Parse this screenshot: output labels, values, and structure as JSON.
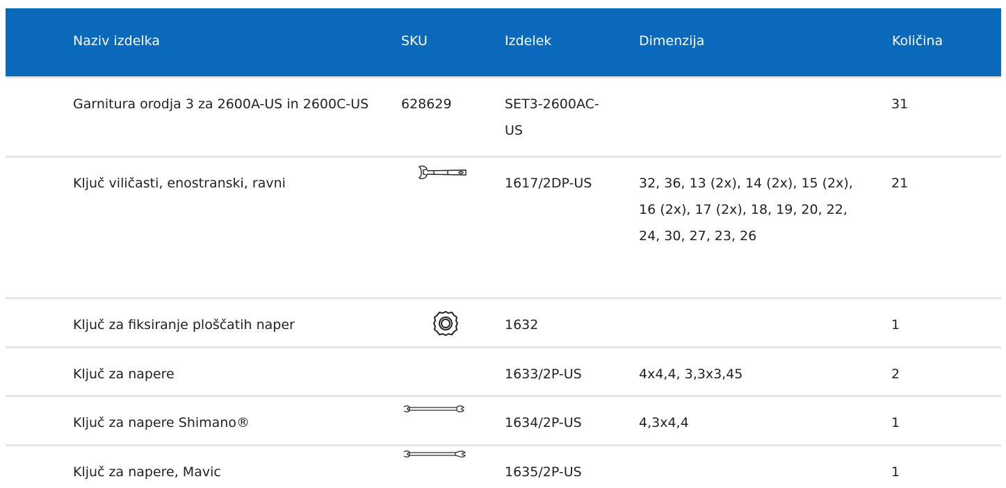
{
  "header": {
    "name": "Naziv izdelka",
    "sku": "SKU",
    "item": "Izdelek",
    "dimension": "Dimenzija",
    "quantity": "Količina"
  },
  "colors": {
    "header_bg": "#0a69bb",
    "header_text": "#ffffff",
    "row_divider": "#e6e6e6"
  },
  "rows": [
    {
      "name": "Garnitura orodja 3 za 2600A-US in 2600C-US",
      "sku": "628629",
      "icon": "",
      "item": "SET3-2600AC-US",
      "dimension": "",
      "quantity": "31"
    },
    {
      "name": "Ključ viličasti, enostranski, ravni",
      "sku": "",
      "icon": "open-end-wrench-icon",
      "item": "1617/2DP-US",
      "dimension": "32, 36, 13 (2x), 14 (2x), 15 (2x), 16 (2x), 17 (2x), 18, 19, 20, 22, 24, 30, 27, 23, 26",
      "quantity": "21"
    },
    {
      "name": "Ključ za fiksiranje ploščatih naper",
      "sku": "",
      "icon": "ring-wrench-icon",
      "item": "1632",
      "dimension": "",
      "quantity": "1"
    },
    {
      "name": "Ključ za napere",
      "sku": "",
      "icon": "",
      "item": "1633/2P-US",
      "dimension": "4x4,4, 3,3x3,45",
      "quantity": "2"
    },
    {
      "name": "Ključ za napere Shimano®",
      "sku": "",
      "icon": "spoke-wrench-icon",
      "item": "1634/2P-US",
      "dimension": "4,3x4,4",
      "quantity": "1"
    },
    {
      "name": "Ključ za napere, Mavic",
      "sku": "",
      "icon": "spoke-wrench-icon",
      "item": "1635/2P-US",
      "dimension": "",
      "quantity": "1"
    }
  ]
}
